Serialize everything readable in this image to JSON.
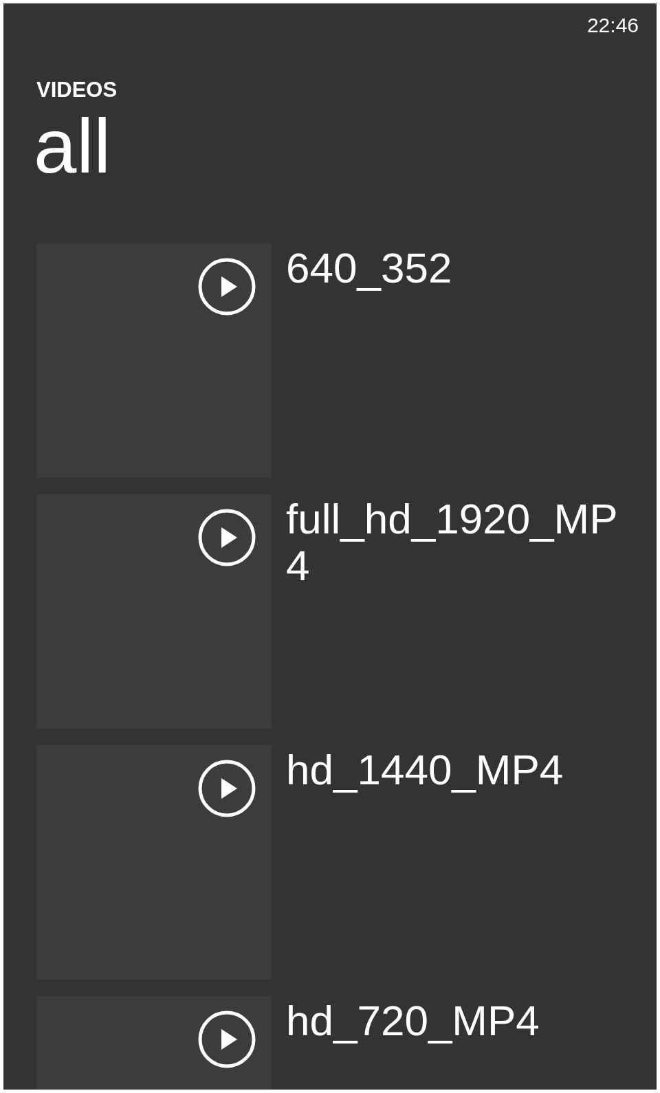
{
  "status_bar": {
    "time": "22:46"
  },
  "header": {
    "app_title": "VIDEOS",
    "page_title": "all"
  },
  "videos": [
    {
      "title": "640_352"
    },
    {
      "title": "full_hd_1920_MP4"
    },
    {
      "title": "hd_1440_MP4"
    },
    {
      "title": "hd_720_MP4"
    }
  ]
}
